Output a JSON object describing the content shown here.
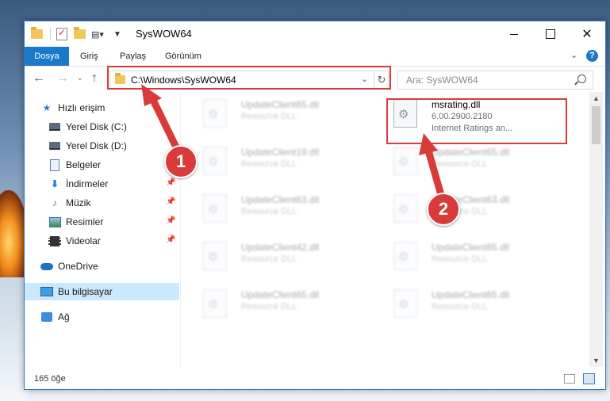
{
  "window": {
    "title": "SysWOW64"
  },
  "ribbon": {
    "tabs": [
      "Dosya",
      "Giriş",
      "Paylaş",
      "Görünüm"
    ],
    "help": "?"
  },
  "address": {
    "path": "C:\\Windows\\SysWOW64"
  },
  "search": {
    "placeholder": "Ara: SysWOW64"
  },
  "sidebar": {
    "items": [
      {
        "label": "Hızlı erişim",
        "icon": "star-icon"
      },
      {
        "label": "Yerel Disk (C:)",
        "icon": "disk-icon"
      },
      {
        "label": "Yerel Disk (D:)",
        "icon": "disk-icon"
      },
      {
        "label": "Belgeler",
        "icon": "documents-icon"
      },
      {
        "label": "İndirmeler",
        "icon": "download-icon"
      },
      {
        "label": "Müzik",
        "icon": "music-icon"
      },
      {
        "label": "Resimler",
        "icon": "pictures-icon"
      },
      {
        "label": "Videolar",
        "icon": "videos-icon"
      },
      {
        "label": "OneDrive",
        "icon": "cloud-icon"
      },
      {
        "label": "Bu bilgisayar",
        "icon": "computer-icon"
      },
      {
        "label": "Ağ",
        "icon": "network-icon"
      }
    ]
  },
  "files": {
    "highlighted": {
      "name": "msrating.dll",
      "version": "6.00.2900.2180",
      "description": "Internet Ratings an..."
    },
    "left_column": [
      {
        "name": "UpdateClient65.dll",
        "type": "Resource DLL"
      },
      {
        "name": "UpdateClient19.dll",
        "type": "Resource DLL"
      },
      {
        "name": "UpdateClient63.dll",
        "type": "Resource DLL"
      },
      {
        "name": "UpdateClient42.dll",
        "type": "Resource DLL"
      },
      {
        "name": "UpdateClient65.dll",
        "type": "Resource DLL"
      }
    ],
    "right_column": [
      {
        "name": "UpdateClient65.dll",
        "type": "Resource DLL"
      },
      {
        "name": "UpdateClient63.dll",
        "type": "Resource DLL"
      },
      {
        "name": "UpdateClient65.dll",
        "type": "Resource DLL"
      },
      {
        "name": "UpdateClient65.dll",
        "type": "Resource DLL"
      }
    ]
  },
  "status": {
    "count": "165 öğe"
  },
  "annotations": {
    "step1": "1",
    "step2": "2",
    "color": "#d93a3a"
  }
}
